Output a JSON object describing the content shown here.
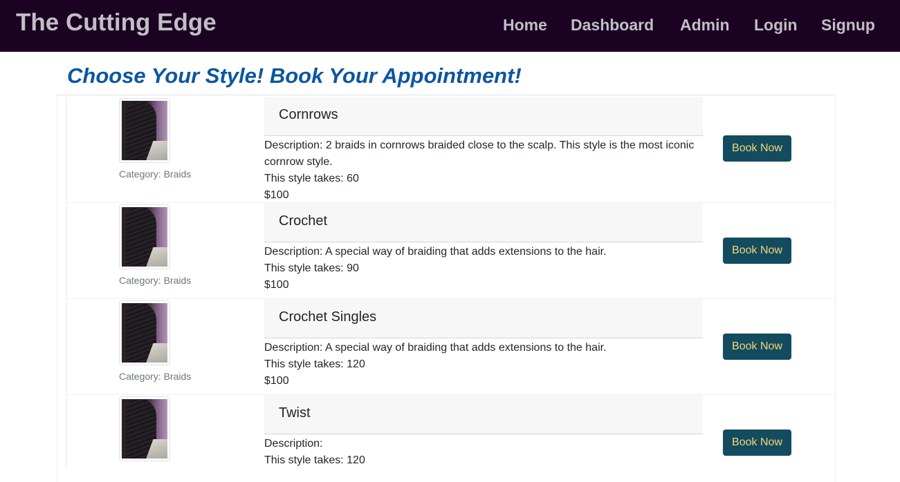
{
  "navbar": {
    "brand": "The Cutting Edge",
    "links": [
      "Home",
      "Dashboard",
      "Admin",
      "Login",
      "Signup"
    ]
  },
  "page": {
    "heading": "Choose Your Style! Book Your Appointment!"
  },
  "styles": [
    {
      "name": "Cornrows",
      "category": "Category: Braids",
      "description_lines": [
        "Description: 2 braids in cornrows braided close to the scalp. This style is the most iconic",
        "cornrow style."
      ],
      "duration": "This style takes: 60",
      "price": "$100",
      "button": "Book Now"
    },
    {
      "name": "Crochet",
      "category": "Category: Braids",
      "description_lines": [
        "Description: A special way of braiding that adds extensions to the hair."
      ],
      "duration": "This style takes: 90",
      "price": "$100",
      "button": "Book Now"
    },
    {
      "name": "Crochet Singles",
      "category": "Category: Braids",
      "description_lines": [
        "Description: A special way of braiding that adds extensions to the hair."
      ],
      "duration": "This style takes: 120",
      "price": "$100",
      "button": "Book Now"
    },
    {
      "name": "Twist",
      "category": "",
      "description_lines": [
        "Description:"
      ],
      "duration": "This style takes: 120",
      "price": "",
      "button": "Book Now"
    }
  ],
  "colors": {
    "navbar_bg": "#1b0223",
    "nav_text": "#c1bfc5",
    "heading": "#0c56a0",
    "button_bg": "#134b5f",
    "button_text": "#f5d777"
  }
}
